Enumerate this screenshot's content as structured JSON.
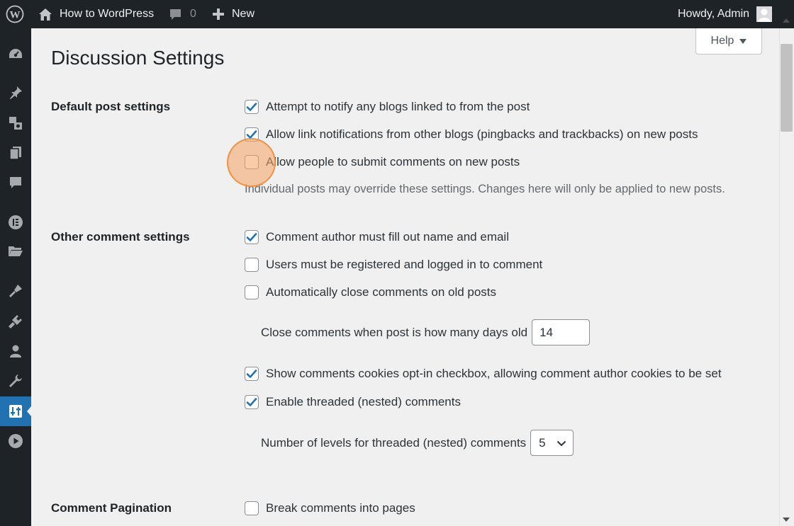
{
  "adminbar": {
    "site_name": "How to WordPress",
    "comments_count": "0",
    "new_label": "New",
    "greeting": "Howdy, Admin"
  },
  "help": {
    "label": "Help"
  },
  "page": {
    "title": "Discussion Settings"
  },
  "sections": {
    "default_post": {
      "label": "Default post settings",
      "options": [
        {
          "label": "Attempt to notify any blogs linked to from the post",
          "checked": true
        },
        {
          "label": "Allow link notifications from other blogs (pingbacks and trackbacks) on new posts",
          "checked": true
        },
        {
          "label": "Allow people to submit comments on new posts",
          "checked": false
        }
      ],
      "description": "Individual posts may override these settings. Changes here will only be applied to new posts."
    },
    "other_comment": {
      "label": "Other comment settings",
      "options": [
        {
          "label": "Comment author must fill out name and email",
          "checked": true
        },
        {
          "label": "Users must be registered and logged in to comment",
          "checked": false
        },
        {
          "label": "Automatically close comments on old posts",
          "checked": false
        },
        {
          "label": "Show comments cookies opt-in checkbox, allowing comment author cookies to be set",
          "checked": true
        },
        {
          "label": "Enable threaded (nested) comments",
          "checked": true
        }
      ],
      "close_days_label": "Close comments when post is how many days old",
      "close_days_value": "14",
      "thread_levels_label": "Number of levels for threaded (nested) comments",
      "thread_levels_value": "5"
    },
    "pagination": {
      "label": "Comment Pagination",
      "options": [
        {
          "label": "Break comments into pages",
          "checked": false
        }
      ]
    }
  },
  "sidebar_icons": [
    "dashboard-icon",
    "pin-icon",
    "media-icon",
    "pages-icon",
    "comments-icon",
    "elementor-icon",
    "folder-icon",
    "appearance-icon",
    "plugins-icon",
    "users-icon",
    "tools-icon",
    "settings-icon",
    "play-icon"
  ],
  "colors": {
    "accent": "#2271b1",
    "admin_bar": "#1d2327",
    "highlight": "#f6a360"
  }
}
